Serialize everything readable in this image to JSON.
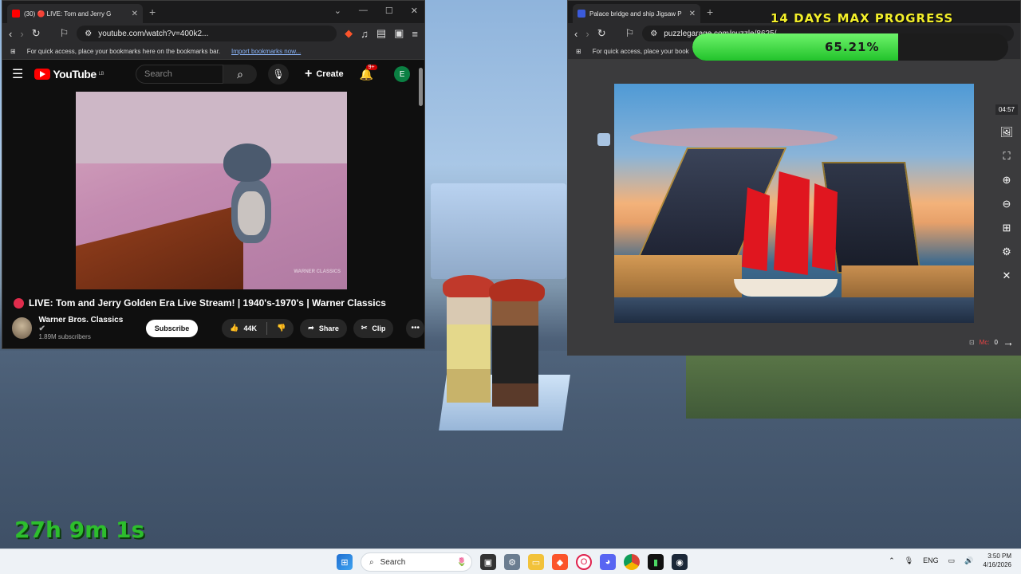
{
  "overlay": {
    "progress_title": "14 DAYS MAX PROGRESS",
    "progress_text": "65.21%",
    "progress_fraction": 0.6521,
    "session_timer": "27h 9m 1s"
  },
  "left_browser": {
    "tab_title": "(30) 🔴 LIVE: Tom and Jerry G",
    "url": "youtube.com/watch?v=400k2...",
    "bookmarks_hint": "For quick access, place your bookmarks here on the bookmarks bar.",
    "bookmarks_link": "Import bookmarks now..."
  },
  "youtube": {
    "logo": "YouTube",
    "logo_sup": "LB",
    "search_placeholder": "Search",
    "create_label": "Create",
    "notif_badge": "9+",
    "avatar_letter": "E",
    "video_watermark": "WARNER CLASSICS",
    "title": "LIVE: Tom and Jerry Golden Era Live Stream! | 1940's-1970's | Warner Classics",
    "channel_name": "Warner Bros. Classics",
    "subscribers": "1.89M subscribers",
    "subscribe_label": "Subscribe",
    "likes": "44K",
    "share_label": "Share",
    "clip_label": "Clip"
  },
  "right_browser": {
    "tab_title": "Palace bridge and ship Jigsaw P",
    "url": "puzzlegarage.com/puzzle/8625/",
    "bookmarks_hint": "For quick access, place your book"
  },
  "puzzle": {
    "timer": "04:57",
    "moves_label": "Mc:",
    "moves_value": "0"
  },
  "taskbar": {
    "search_label": "Search",
    "language": "ENG",
    "time": "3:50 PM",
    "date": "4/16/2026"
  },
  "colors": {
    "progress_fill": "#22c32b",
    "progress_title": "#f3ef2a",
    "session_timer": "#2dbe2d",
    "youtube_red": "#ff0000"
  }
}
